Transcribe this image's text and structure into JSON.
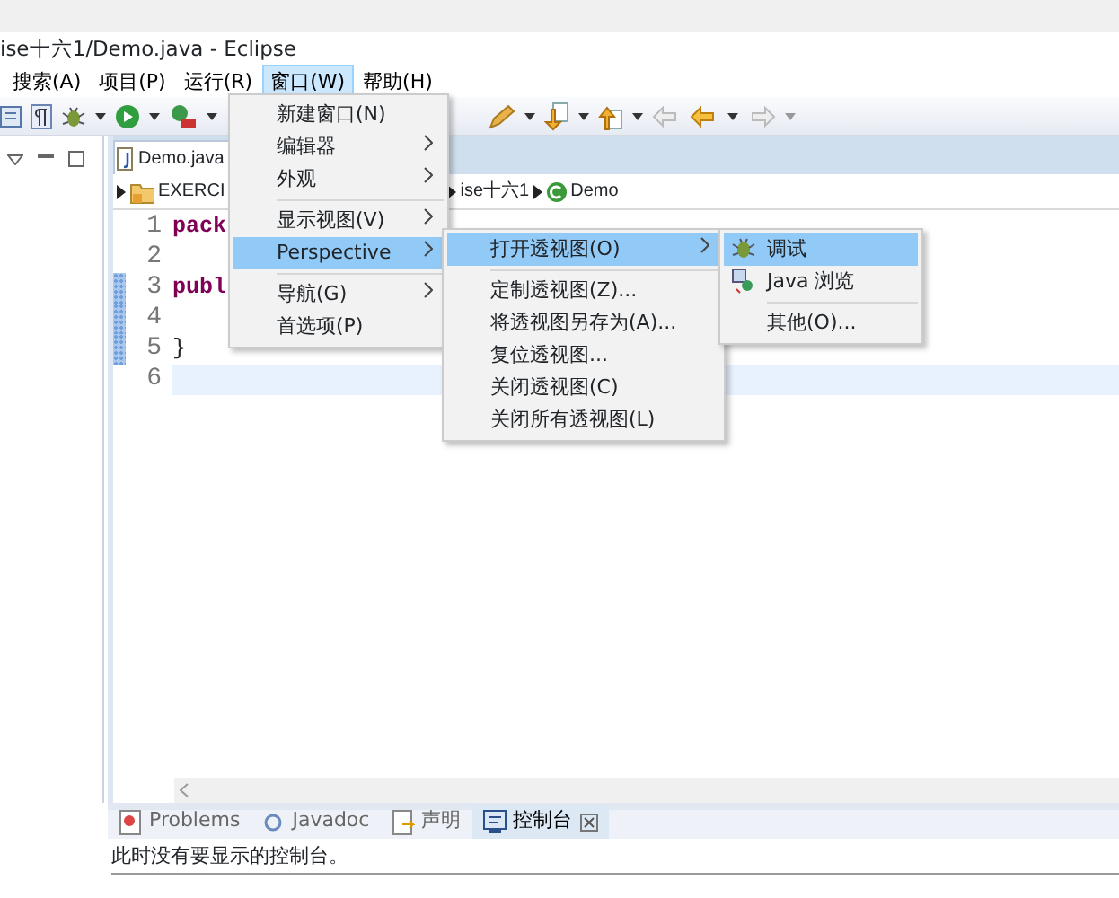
{
  "window": {
    "title": "ise十六1/Demo.java - Eclipse"
  },
  "menu_bar": [
    {
      "label": "搜索(A)",
      "selected": false
    },
    {
      "label": "项目(P)",
      "selected": false
    },
    {
      "label": "运行(R)",
      "selected": false
    },
    {
      "label": "窗口(W)",
      "selected": true
    },
    {
      "label": "帮助(H)",
      "selected": false
    }
  ],
  "editor": {
    "tab": "Demo.java",
    "breadcrumb": [
      "EXERCI",
      "ise十六1",
      "Demo"
    ],
    "lines": [
      {
        "number": "1",
        "text": "pack",
        "keyword": true,
        "highlighted": false,
        "changed": false
      },
      {
        "number": "2",
        "highlighted": false,
        "changed": false
      },
      {
        "number": "3",
        "text": "publ",
        "keyword": true,
        "highlighted": false,
        "changed": true
      },
      {
        "number": "4",
        "highlighted": false,
        "changed": true
      },
      {
        "number": "5",
        "text": "}",
        "keyword": false,
        "highlighted": false,
        "changed": true
      },
      {
        "number": "6",
        "highlighted": true,
        "changed": false
      }
    ]
  },
  "bottom_tabs": [
    {
      "label": "Problems",
      "selected": false
    },
    {
      "label": "Javadoc",
      "selected": false
    },
    {
      "label": "声明",
      "selected": false
    },
    {
      "label": "控制台",
      "selected": true
    }
  ],
  "console_message": "此时没有要显示的控制台。",
  "window_menu": [
    {
      "kind": "item",
      "label": "新建窗口(N)",
      "submenu": false,
      "selected": false
    },
    {
      "kind": "item",
      "label": "编辑器",
      "submenu": true,
      "selected": false
    },
    {
      "kind": "item",
      "label": "外观",
      "submenu": true,
      "selected": false
    },
    {
      "kind": "separator"
    },
    {
      "kind": "item",
      "label": "显示视图(V)",
      "submenu": true,
      "selected": false
    },
    {
      "kind": "item",
      "label": "Perspective",
      "submenu": true,
      "selected": true
    },
    {
      "kind": "separator"
    },
    {
      "kind": "item",
      "label": "导航(G)",
      "submenu": true,
      "selected": false
    },
    {
      "kind": "item",
      "label": "首选项(P)",
      "submenu": false,
      "selected": false
    }
  ],
  "perspective_menu": [
    {
      "kind": "item",
      "label": "打开透视图(O)",
      "submenu": true,
      "selected": true
    },
    {
      "kind": "separator"
    },
    {
      "kind": "item",
      "label": "定制透视图(Z)...",
      "submenu": false,
      "selected": false
    },
    {
      "kind": "item",
      "label": "将透视图另存为(A)...",
      "submenu": false,
      "selected": false
    },
    {
      "kind": "item",
      "label": "复位透视图...",
      "submenu": false,
      "selected": false
    },
    {
      "kind": "item",
      "label": "关闭透视图(C)",
      "submenu": false,
      "selected": false
    },
    {
      "kind": "item",
      "label": "关闭所有透视图(L)",
      "submenu": false,
      "selected": false
    }
  ],
  "open_perspective_menu": [
    {
      "kind": "item",
      "label": "调试",
      "submenu": false,
      "selected": true
    },
    {
      "kind": "item",
      "label": "Java 浏览",
      "submenu": false,
      "selected": false
    },
    {
      "kind": "separator"
    },
    {
      "kind": "item",
      "label": "其他(O)...",
      "submenu": false,
      "selected": false
    }
  ]
}
